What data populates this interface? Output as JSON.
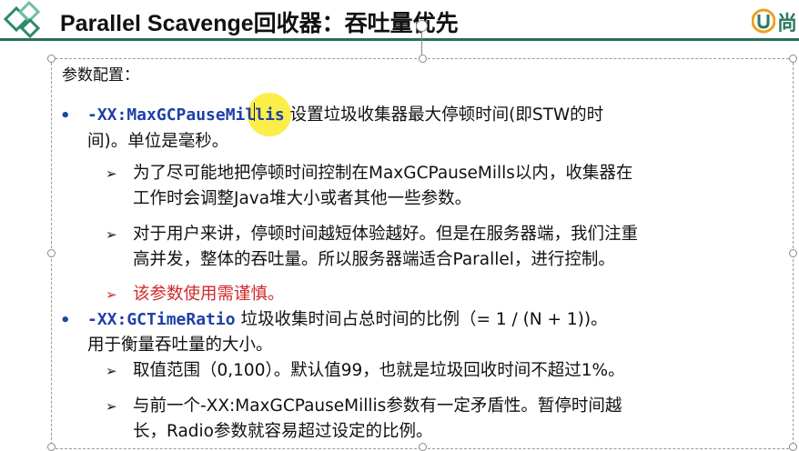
{
  "slide": {
    "title": "Parallel Scavenge回收器：吞吐量优先",
    "brand_text": "尚",
    "accent_color": "#2a6e57",
    "intro": "参数配置：",
    "bullets": [
      {
        "param": "-XX:MaxGCPauseMillis",
        "line1": " 设置垃圾收集器最大停顿时间(即STW的时",
        "line2": "间)。单位是毫秒。",
        "subs": [
          {
            "line1": "为了尽可能地把停顿时间控制在MaxGCPauseMills以内，收集器在",
            "line2": "工作时会调整Java堆大小或者其他一些参数。"
          },
          {
            "line1": "对于用户来讲，停顿时间越短体验越好。但是在服务器端，我们注重",
            "line2": "高并发，整体的吞吐量。所以服务器端适合Parallel，进行控制。"
          },
          {
            "line1": "该参数使用需谨慎。"
          }
        ]
      },
      {
        "param": "-XX:GCTimeRatio",
        "line1": " 垃圾收集时间占总时间的比例（= 1 / (N + 1))。",
        "line2": "用于衡量吞吐量的大小。",
        "subs": [
          {
            "line1": "取值范围（0,100）。默认值99，也就是垃圾回收时间不超过1%。"
          },
          {
            "line1": "与前一个-XX:MaxGCPauseMillis参数有一定矛盾性。暂停时间越",
            "line2": "长，Radio参数就容易超过设定的比例。"
          }
        ]
      }
    ],
    "bullet_glyph": "•",
    "arrow_glyph": "➢"
  }
}
